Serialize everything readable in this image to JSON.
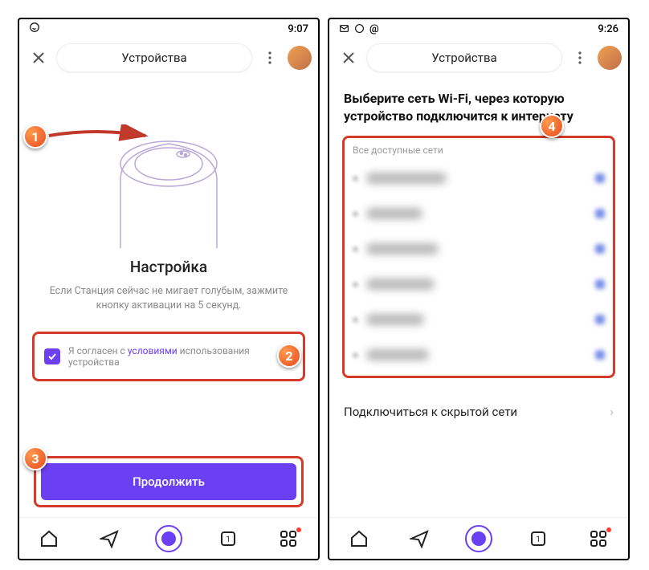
{
  "statusbar": {
    "time1": "9:07",
    "time2": "9:26"
  },
  "topbar": {
    "title": "Устройства"
  },
  "screen1": {
    "title": "Настройка",
    "description": "Если Станция сейчас не мигает голубым, зажмите кнопку активации на 5 секунд.",
    "terms_prefix": "Я согласен с ",
    "terms_link": "условиями",
    "terms_suffix": " использования устройства",
    "continue_label": "Продолжить"
  },
  "screen2": {
    "heading": "Выберите сеть Wi-Fi, через которую устройство подключится к интернету",
    "subheading": "Все доступные сети",
    "hidden_label": "Подключиться к скрытой сети",
    "network_count": 6
  },
  "markers": {
    "m1": "1",
    "m2": "2",
    "m3": "3",
    "m4": "4"
  },
  "colors": {
    "accent": "#6b3ff2",
    "callout": "#d43b2a"
  }
}
